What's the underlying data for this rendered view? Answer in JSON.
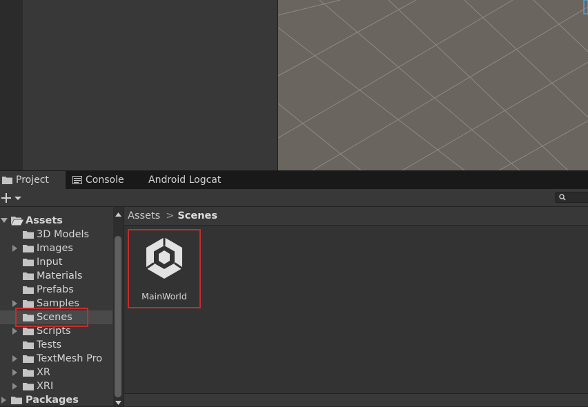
{
  "tabs": [
    {
      "label": "Project",
      "icon": "folder-icon",
      "active": true
    },
    {
      "label": "Console",
      "icon": "console-icon",
      "active": false
    },
    {
      "label": "Android Logcat",
      "icon": "",
      "active": false
    }
  ],
  "toolbar": {
    "add_icon": "plus-icon",
    "search_icon": "search-icon",
    "search_value": ""
  },
  "tree": {
    "assets_label": "Assets",
    "items": [
      {
        "label": "3D Models",
        "expandable": false
      },
      {
        "label": "Images",
        "expandable": true
      },
      {
        "label": "Input",
        "expandable": false
      },
      {
        "label": "Materials",
        "expandable": false
      },
      {
        "label": "Prefabs",
        "expandable": false
      },
      {
        "label": "Samples",
        "expandable": true
      },
      {
        "label": "Scenes",
        "expandable": false,
        "selected": true
      },
      {
        "label": "Scripts",
        "expandable": true
      },
      {
        "label": "Tests",
        "expandable": false
      },
      {
        "label": "TextMesh Pro",
        "expandable": true
      },
      {
        "label": "XR",
        "expandable": true
      },
      {
        "label": "XRI",
        "expandable": true
      }
    ],
    "packages_label": "Packages"
  },
  "breadcrumb": {
    "root": "Assets",
    "current": "Scenes",
    "separator": ">"
  },
  "assets": [
    {
      "name": "MainWorld",
      "icon": "unity-scene-icon"
    }
  ],
  "colors": {
    "highlight": "#c92b2b",
    "panel": "#383838",
    "scene_ground": "#6b6560"
  }
}
